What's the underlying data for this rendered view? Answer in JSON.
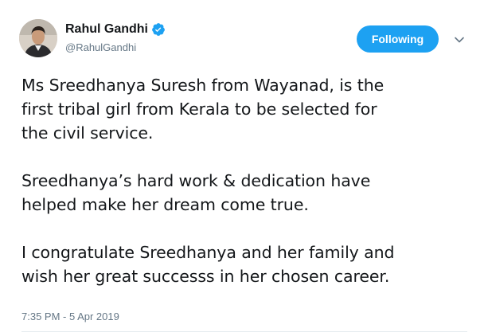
{
  "user": {
    "name": "Rahul Gandhi",
    "handle": "@RahulGandhi",
    "verified": true,
    "verified_icon": "verified-badge-icon"
  },
  "follow_button": {
    "label": "Following",
    "color": "#1da1f2"
  },
  "menu_icon": "chevron-down-icon",
  "tweet": {
    "paragraphs": [
      "Ms Sreedhanya Suresh from Wayanad, is the\nfirst tribal girl from Kerala to be selected for\nthe civil service.",
      "Sreedhanya’s hard work & dedication have\nhelped make her dream come true.",
      "I congratulate Sreedhanya and her family and\nwish her great successs in her chosen career."
    ],
    "timestamp": "7:35 PM - 5 Apr 2019"
  },
  "colors": {
    "text": "#14171a",
    "secondary": "#657786",
    "accent": "#1da1f2"
  }
}
